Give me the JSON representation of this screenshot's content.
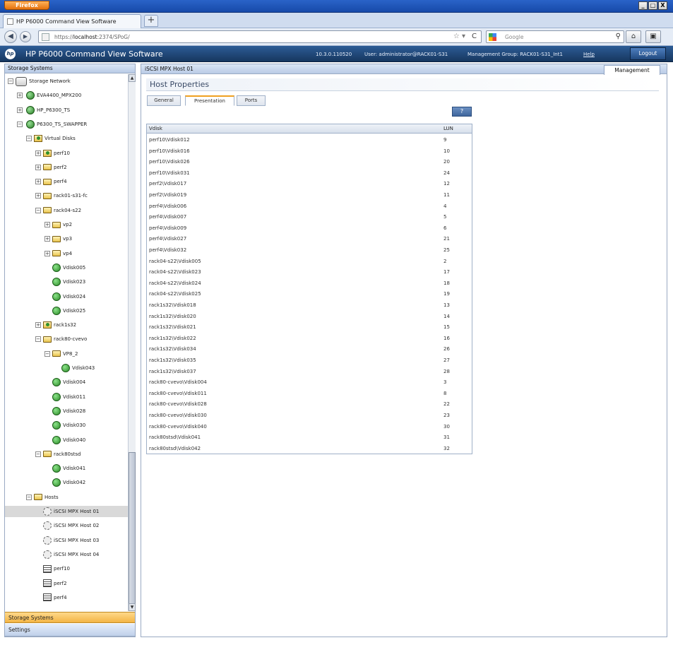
{
  "browser": {
    "menu_button": "Firefox",
    "tab_title": "HP P6000 Command View Software",
    "url_prefix": "https://",
    "url_host": "localhost",
    "url_rest": ":2374/SPoG/",
    "search_placeholder": "Google",
    "window_minimize": "_",
    "window_restore": "□",
    "window_close": "X"
  },
  "app_header": {
    "title": "HP P6000 Command View Software",
    "version": "10.3.0.110520",
    "user": "User: administrator@RACK01-S31",
    "management_group": "Management Group: RACK01-S31_Int1",
    "help": "Help",
    "logout": "Logout"
  },
  "left_panel": {
    "header": "Storage Systems",
    "tree": [
      {
        "label": "Storage Network",
        "icon": "network-icon",
        "depth": 0,
        "expander": "−"
      },
      {
        "label": "EVA4400_MPX200",
        "icon": "storage-system-icon",
        "depth": 1,
        "expander": "+"
      },
      {
        "label": "HP_P6300_TS",
        "icon": "storage-system-icon",
        "depth": 1,
        "expander": "+"
      },
      {
        "label": "P6300_TS_SWAPPER",
        "icon": "storage-system-icon",
        "depth": 1,
        "expander": "−"
      },
      {
        "label": "Virtual Disks",
        "icon": "vdisk-folder-icon",
        "depth": 2,
        "expander": "−"
      },
      {
        "label": "perf10",
        "icon": "vdisk-folder-icon",
        "depth": 3,
        "expander": "+"
      },
      {
        "label": "perf2",
        "icon": "folder-icon",
        "depth": 3,
        "expander": "+"
      },
      {
        "label": "perf4",
        "icon": "folder-icon",
        "depth": 3,
        "expander": "+"
      },
      {
        "label": "rack01-s31-fc",
        "icon": "folder-icon",
        "depth": 3,
        "expander": "+"
      },
      {
        "label": "rack04-s22",
        "icon": "folder-icon",
        "depth": 3,
        "expander": "−"
      },
      {
        "label": "vp2",
        "icon": "folder-icon",
        "depth": 4,
        "expander": "+"
      },
      {
        "label": "vp3",
        "icon": "folder-icon",
        "depth": 4,
        "expander": "+"
      },
      {
        "label": "vp4",
        "icon": "folder-icon",
        "depth": 4,
        "expander": "+"
      },
      {
        "label": "Vdisk005",
        "icon": "vdisk-icon",
        "depth": 4,
        "expander": ""
      },
      {
        "label": "Vdisk023",
        "icon": "vdisk-icon",
        "depth": 4,
        "expander": ""
      },
      {
        "label": "Vdisk024",
        "icon": "vdisk-icon",
        "depth": 4,
        "expander": ""
      },
      {
        "label": "Vdisk025",
        "icon": "vdisk-icon",
        "depth": 4,
        "expander": ""
      },
      {
        "label": "rack1s32",
        "icon": "vdisk-folder-icon",
        "depth": 3,
        "expander": "+"
      },
      {
        "label": "rack80-cvevo",
        "icon": "folder-icon",
        "depth": 3,
        "expander": "−"
      },
      {
        "label": "VP8_2",
        "icon": "folder-icon",
        "depth": 4,
        "expander": "−"
      },
      {
        "label": "Vdisk043",
        "icon": "vdisk-icon",
        "depth": 5,
        "expander": ""
      },
      {
        "label": "Vdisk004",
        "icon": "vdisk-icon",
        "depth": 4,
        "expander": ""
      },
      {
        "label": "Vdisk011",
        "icon": "vdisk-icon",
        "depth": 4,
        "expander": ""
      },
      {
        "label": "Vdisk028",
        "icon": "vdisk-icon",
        "depth": 4,
        "expander": ""
      },
      {
        "label": "Vdisk030",
        "icon": "vdisk-icon",
        "depth": 4,
        "expander": ""
      },
      {
        "label": "Vdisk040",
        "icon": "vdisk-icon",
        "depth": 4,
        "expander": ""
      },
      {
        "label": "rack80stsd",
        "icon": "folder-icon",
        "depth": 3,
        "expander": "−"
      },
      {
        "label": "Vdisk041",
        "icon": "vdisk-icon",
        "depth": 4,
        "expander": ""
      },
      {
        "label": "Vdisk042",
        "icon": "vdisk-icon",
        "depth": 4,
        "expander": ""
      },
      {
        "label": "Hosts",
        "icon": "folder-icon",
        "depth": 2,
        "expander": "−"
      },
      {
        "label": "iSCSI MPX Host 01",
        "icon": "host-icon",
        "depth": 3,
        "expander": "",
        "selected": true
      },
      {
        "label": "iSCSI MPX Host 02",
        "icon": "host-icon",
        "depth": 3,
        "expander": ""
      },
      {
        "label": "iSCSI MPX Host 03",
        "icon": "host-icon",
        "depth": 3,
        "expander": ""
      },
      {
        "label": "iSCSI MPX Host 04",
        "icon": "host-icon",
        "depth": 3,
        "expander": ""
      },
      {
        "label": "perf10",
        "icon": "disk-list-icon",
        "depth": 3,
        "expander": ""
      },
      {
        "label": "perf2",
        "icon": "disk-list-icon",
        "depth": 3,
        "expander": ""
      },
      {
        "label": "perf4",
        "icon": "disk-list-icon",
        "depth": 3,
        "expander": ""
      }
    ],
    "accordion_storage": "Storage Systems",
    "accordion_settings": "Settings"
  },
  "right_panel": {
    "title": "iSCSI MPX Host 01",
    "management_tab": "Management",
    "heading": "Host Properties",
    "tabs": [
      {
        "label": "General",
        "active": false
      },
      {
        "label": "Presentation",
        "active": true
      },
      {
        "label": "Ports",
        "active": false
      }
    ],
    "help_button": "?",
    "table": {
      "columns": [
        "Vdisk",
        "LUN"
      ],
      "rows": [
        {
          "vdisk": "perf10\\Vdisk012",
          "lun": "9"
        },
        {
          "vdisk": "perf10\\Vdisk016",
          "lun": "10"
        },
        {
          "vdisk": "perf10\\Vdisk026",
          "lun": "20"
        },
        {
          "vdisk": "perf10\\Vdisk031",
          "lun": "24"
        },
        {
          "vdisk": "perf2\\Vdisk017",
          "lun": "12"
        },
        {
          "vdisk": "perf2\\Vdisk019",
          "lun": "11"
        },
        {
          "vdisk": "perf4\\Vdisk006",
          "lun": "4"
        },
        {
          "vdisk": "perf4\\Vdisk007",
          "lun": "5"
        },
        {
          "vdisk": "perf4\\Vdisk009",
          "lun": "6"
        },
        {
          "vdisk": "perf4\\Vdisk027",
          "lun": "21"
        },
        {
          "vdisk": "perf4\\Vdisk032",
          "lun": "25"
        },
        {
          "vdisk": "rack04-s22\\Vdisk005",
          "lun": "2"
        },
        {
          "vdisk": "rack04-s22\\Vdisk023",
          "lun": "17"
        },
        {
          "vdisk": "rack04-s22\\Vdisk024",
          "lun": "18"
        },
        {
          "vdisk": "rack04-s22\\Vdisk025",
          "lun": "19"
        },
        {
          "vdisk": "rack1s32\\Vdisk018",
          "lun": "13"
        },
        {
          "vdisk": "rack1s32\\Vdisk020",
          "lun": "14"
        },
        {
          "vdisk": "rack1s32\\Vdisk021",
          "lun": "15"
        },
        {
          "vdisk": "rack1s32\\Vdisk022",
          "lun": "16"
        },
        {
          "vdisk": "rack1s32\\Vdisk034",
          "lun": "26"
        },
        {
          "vdisk": "rack1s32\\Vdisk035",
          "lun": "27"
        },
        {
          "vdisk": "rack1s32\\Vdisk037",
          "lun": "28"
        },
        {
          "vdisk": "rack80-cvevo\\Vdisk004",
          "lun": "3"
        },
        {
          "vdisk": "rack80-cvevo\\Vdisk011",
          "lun": "8"
        },
        {
          "vdisk": "rack80-cvevo\\Vdisk028",
          "lun": "22"
        },
        {
          "vdisk": "rack80-cvevo\\Vdisk030",
          "lun": "23"
        },
        {
          "vdisk": "rack80-cvevo\\Vdisk040",
          "lun": "30"
        },
        {
          "vdisk": "rack80stsd\\Vdisk041",
          "lun": "31"
        },
        {
          "vdisk": "rack80stsd\\Vdisk042",
          "lun": "32"
        }
      ]
    }
  }
}
